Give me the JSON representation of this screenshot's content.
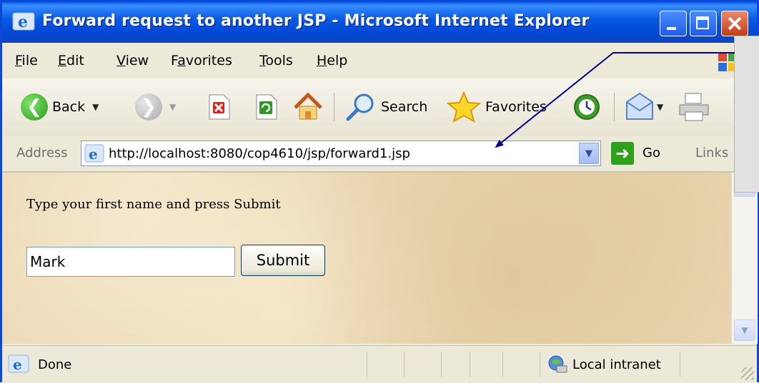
{
  "window": {
    "title": "Forward request to another JSP - Microsoft Internet Explorer"
  },
  "menu": {
    "items": [
      {
        "label": "File",
        "accel": "F"
      },
      {
        "label": "Edit",
        "accel": "E"
      },
      {
        "label": "View",
        "accel": "V"
      },
      {
        "label": "Favorites",
        "accel": "a"
      },
      {
        "label": "Tools",
        "accel": "T"
      },
      {
        "label": "Help",
        "accel": "H"
      }
    ]
  },
  "toolbar": {
    "back_label": "Back",
    "search_label": "Search",
    "favorites_label": "Favorites"
  },
  "address": {
    "label": "Address",
    "url": "http://localhost:8080/cop4610/jsp/forward1.jsp",
    "go_label": "Go",
    "links_label": "Links"
  },
  "page": {
    "prompt": "Type your first name and press Submit",
    "name_value": "Mark",
    "submit_label": "Submit"
  },
  "status": {
    "text": "Done",
    "zone": "Local intranet"
  },
  "colors": {
    "title_bar": "#0a5ce4",
    "close_button": "#c43c14",
    "page_background": "#ead7b3",
    "callout_arrow": "#00008b"
  }
}
